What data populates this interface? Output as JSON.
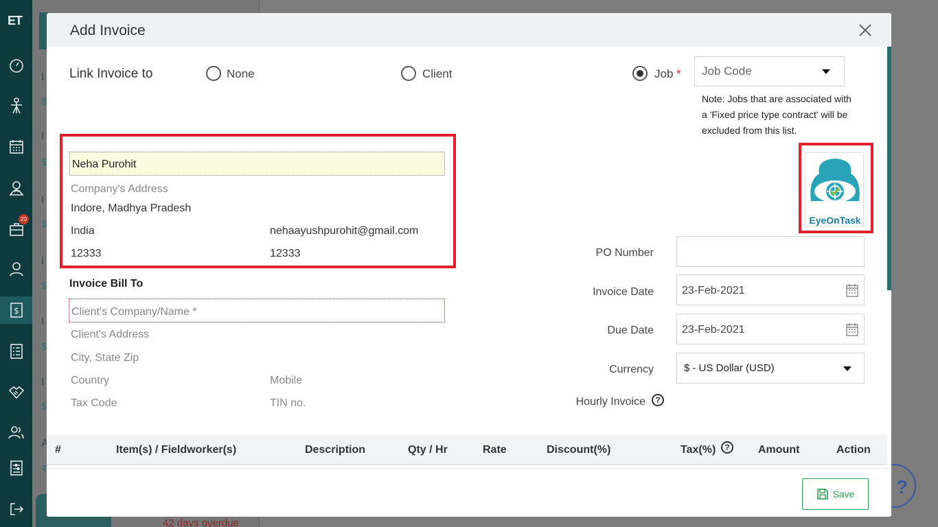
{
  "app": {
    "logo": "ET",
    "notification_count": "20"
  },
  "sidebar": {
    "items": [
      {
        "icon": "dashboard-icon"
      },
      {
        "icon": "jobs-icon"
      },
      {
        "icon": "calendar-icon"
      },
      {
        "icon": "map-icon"
      },
      {
        "icon": "briefcase-icon"
      },
      {
        "icon": "user-icon"
      },
      {
        "icon": "invoice-dollar-icon"
      },
      {
        "icon": "list-icon"
      },
      {
        "icon": "handshake-icon"
      },
      {
        "icon": "team-icon"
      },
      {
        "icon": "settings-sliders-icon"
      },
      {
        "icon": "logout-icon"
      }
    ]
  },
  "background": {
    "overdue_text": "42 days overdue"
  },
  "modal": {
    "title": "Add Invoice",
    "link_invoice_label": "Link Invoice to",
    "radio_none": "None",
    "radio_client": "Client",
    "radio_job": "Job",
    "required_mark": "*",
    "job_code_placeholder": "Job Code",
    "note": "Note: Jobs that are associated with a 'Fixed price type contract' will be excluded from this list.",
    "from": {
      "name": "Neha Purohit",
      "address_placeholder": "Company's Address",
      "city_state": "Indore, Madhya Pradesh",
      "country": "India",
      "email": "nehaayushpurohit@gmail.com",
      "tax_code": "12333",
      "tin": "12333"
    },
    "bill_to": {
      "title": "Invoice Bill To",
      "company_placeholder": "Client's Company/Name *",
      "address_placeholder": "Client's Address",
      "city_placeholder": "City, State Zip",
      "country_placeholder": "Country",
      "mobile_placeholder": "Mobile",
      "tax_code_placeholder": "Tax Code",
      "tin_placeholder": "TIN no."
    },
    "logo_text": "EyeOnTask",
    "po_number_label": "PO Number",
    "po_number_value": "",
    "invoice_date_label": "Invoice Date",
    "invoice_date": "23-Feb-2021",
    "due_date_label": "Due Date",
    "due_date": "23-Feb-2021",
    "currency_label": "Currency",
    "currency_value": "$ - US Dollar (USD)",
    "hourly_invoice_label": "Hourly Invoice",
    "table_headers": {
      "num": "#",
      "items": "Item(s) / Fieldworker(s)",
      "description": "Description",
      "qty": "Qty / Hr",
      "rate": "Rate",
      "discount": "Discount(%)",
      "tax": "Tax(%)",
      "amount": "Amount",
      "action": "Action"
    },
    "save_label": "Save"
  },
  "colors": {
    "accent": "#2e9f52",
    "highlight_border": "#e0202a",
    "sidebar_bg": "#0f3b3e"
  }
}
